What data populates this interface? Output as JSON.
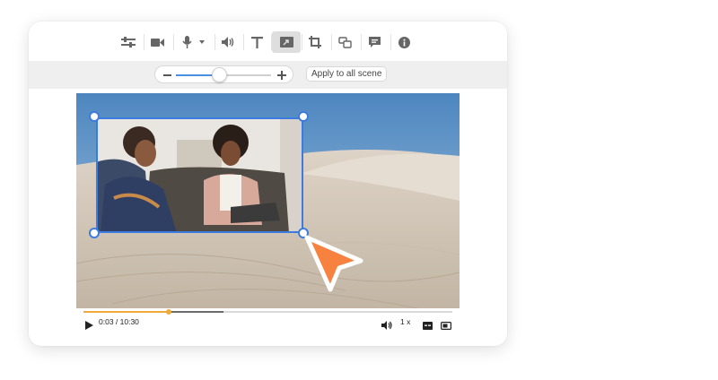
{
  "toolbar": {
    "items": [
      {
        "name": "settings-sliders-icon"
      },
      {
        "name": "camera-icon"
      },
      {
        "name": "microphone-icon"
      },
      {
        "name": "volume-icon"
      },
      {
        "name": "text-icon"
      },
      {
        "name": "media-replace-icon",
        "active": true
      },
      {
        "name": "crop-icon"
      },
      {
        "name": "layers-icon"
      },
      {
        "name": "comment-icon"
      },
      {
        "name": "info-icon"
      }
    ],
    "active_color": "#dedede"
  },
  "zoom": {
    "level": 0.45
  },
  "apply_label": "Apply to all scene",
  "player": {
    "time": "0:03 / 10:30",
    "speed": "1 x",
    "played_fraction": 0.23,
    "buffered_fraction": 0.38
  },
  "colors": {
    "selection": "#3d7be0",
    "cursor": "#f7813e",
    "progress": "#f0a93b"
  }
}
